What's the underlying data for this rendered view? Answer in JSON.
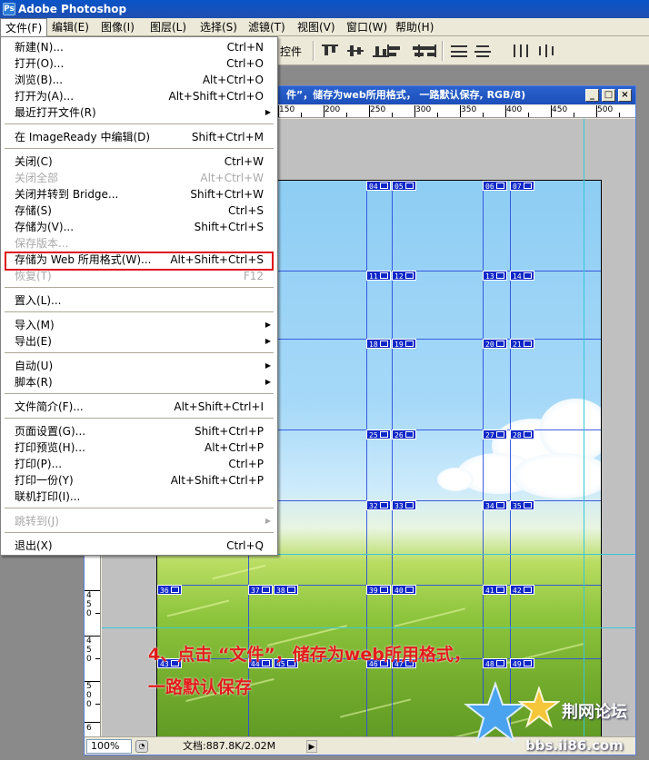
{
  "app": {
    "title": "Adobe Photoshop",
    "icon": "photoshop-app-icon"
  },
  "menubar": [
    {
      "label": "文件(F)"
    },
    {
      "label": "编辑(E)"
    },
    {
      "label": "图像(I)"
    },
    {
      "label": "图层(L)"
    },
    {
      "label": "选择(S)"
    },
    {
      "label": "滤镜(T)"
    },
    {
      "label": "视图(V)"
    },
    {
      "label": "窗口(W)"
    },
    {
      "label": "帮助(H)"
    }
  ],
  "options_bar": {
    "controls_label": "控件"
  },
  "file_menu": {
    "items": [
      {
        "label": "新建(N)...",
        "shortcut": "Ctrl+N"
      },
      {
        "label": "打开(O)...",
        "shortcut": "Ctrl+O"
      },
      {
        "label": "浏览(B)...",
        "shortcut": "Alt+Ctrl+O"
      },
      {
        "label": "打开为(A)...",
        "shortcut": "Alt+Shift+Ctrl+O"
      },
      {
        "label": "最近打开文件(R)",
        "shortcut": ""
      },
      {
        "label": "在 ImageReady 中编辑(D)",
        "shortcut": "Shift+Ctrl+M"
      },
      {
        "label": "关闭(C)",
        "shortcut": "Ctrl+W"
      },
      {
        "label": "关闭全部",
        "shortcut": "Alt+Ctrl+W"
      },
      {
        "label": "关闭并转到 Bridge...",
        "shortcut": "Shift+Ctrl+W"
      },
      {
        "label": "存储(S)",
        "shortcut": "Ctrl+S"
      },
      {
        "label": "存储为(V)...",
        "shortcut": "Shift+Ctrl+S"
      },
      {
        "label": "保存版本...",
        "shortcut": ""
      },
      {
        "label": "存储为 Web 所用格式(W)...",
        "shortcut": "Alt+Shift+Ctrl+S"
      },
      {
        "label": "恢复(T)",
        "shortcut": "F12"
      },
      {
        "label": "置入(L)...",
        "shortcut": ""
      },
      {
        "label": "导入(M)",
        "shortcut": ""
      },
      {
        "label": "导出(E)",
        "shortcut": ""
      },
      {
        "label": "自动(U)",
        "shortcut": ""
      },
      {
        "label": "脚本(R)",
        "shortcut": ""
      },
      {
        "label": "文件简介(F)...",
        "shortcut": "Alt+Shift+Ctrl+I"
      },
      {
        "label": "页面设置(G)...",
        "shortcut": "Shift+Ctrl+P"
      },
      {
        "label": "打印预览(H)...",
        "shortcut": "Alt+Ctrl+P"
      },
      {
        "label": "打印(P)...",
        "shortcut": "Ctrl+P"
      },
      {
        "label": "打印一份(Y)",
        "shortcut": "Alt+Shift+Ctrl+P"
      },
      {
        "label": "联机打印(I)...",
        "shortcut": ""
      },
      {
        "label": "跳转到(J)",
        "shortcut": ""
      },
      {
        "label": "退出(X)",
        "shortcut": "Ctrl+Q"
      }
    ],
    "highlighted_item": "存储为 Web 所用格式(W)..."
  },
  "document": {
    "title_visible": "件”，储存为web所用格式， 一路默认保存, RGB/8)",
    "ruler_h_labels": [
      "150",
      "200",
      "250",
      "300",
      "350",
      "400",
      "450",
      "500"
    ],
    "ruler_v_labels": [
      "4",
      "5",
      "0",
      "4",
      "5",
      "0",
      "5",
      "0",
      "0",
      "5",
      "5",
      "0",
      "6",
      "0",
      "0"
    ],
    "slices": [
      "04",
      "05",
      "06",
      "07",
      "11",
      "12",
      "13",
      "14",
      "18",
      "19",
      "20",
      "21",
      "25",
      "26",
      "27",
      "28",
      "32",
      "33",
      "34",
      "35",
      "36",
      "37",
      "38",
      "39",
      "40",
      "41",
      "42",
      "43",
      "44",
      "45",
      "46",
      "47",
      "48",
      "49"
    ],
    "zoom": "100%",
    "doc_size": "文档:887.8K/2.02M"
  },
  "caption": {
    "line1": "4、点击 “文件”，储存为web所用格式，",
    "line2": "一路默认保存"
  },
  "watermark": {
    "site_name": "荆网论坛",
    "url": "bbs.ii86.com"
  },
  "colors": {
    "highlight_border": "#e01010",
    "caption": "#e41a1a",
    "slice_badge": "#1028c8",
    "guide": "#36c8d6"
  }
}
